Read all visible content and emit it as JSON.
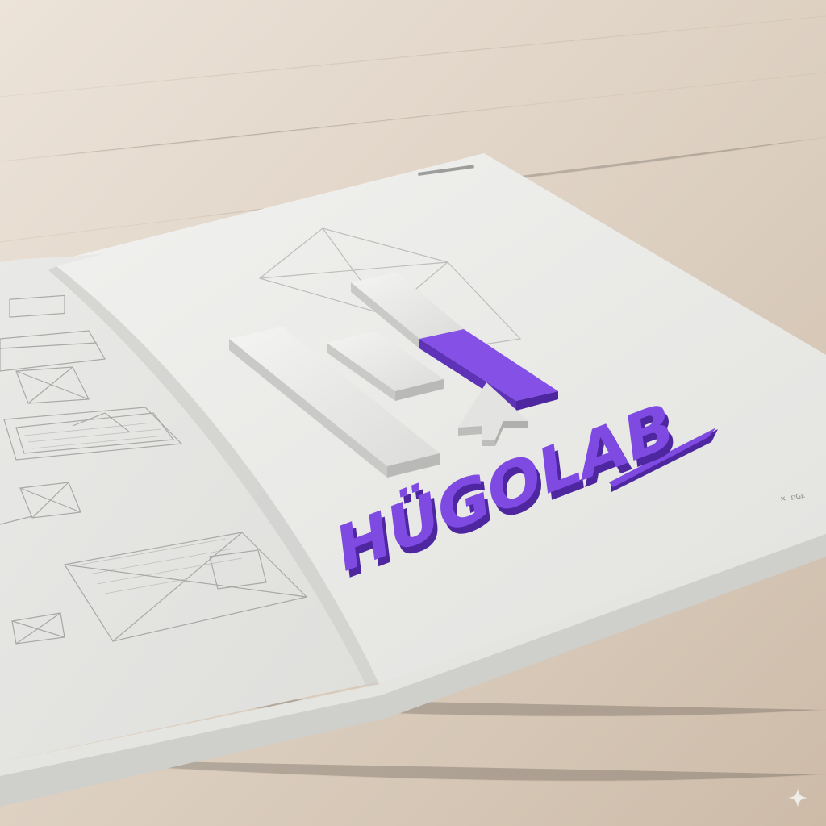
{
  "scene": {
    "description_colors": {
      "desk": "#d9ccbd",
      "page": "#ececea",
      "accent": "#7f4ae2",
      "accent_dark": "#4e27a0"
    }
  },
  "logo": {
    "wordmark": "HÜGOLAB",
    "mark_icon": "bars-with-arrow-icon"
  },
  "corner_icon": "sparkle-icon"
}
